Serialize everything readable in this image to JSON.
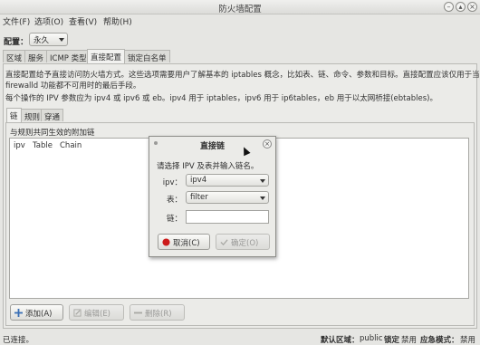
{
  "window": {
    "title": "防火墙配置"
  },
  "menu": [
    "文件(F)",
    "选项(O)",
    "查看(V)",
    "帮助(H)"
  ],
  "config": {
    "label": "配置：",
    "value": "永久"
  },
  "tabs": [
    "区域",
    "服务",
    "ICMP 类型",
    "直接配置",
    "锁定白名单"
  ],
  "description": {
    "line1": "直接配置给予直接访问防火墙方式。这些选项需要用户了解基本的 iptables 概念，比如表、链、命令、参数和目标。直接配置应该仅用于当其他",
    "line2": "firewalld 功能都不可用时的最后手段。",
    "line3": "每个操作的 IPV 参数应为 ipv4 或 ipv6 或 eb。ipv4 用于 iptables，ipv6 用于 ip6tables，eb 用于以太网桥接(ebtables)。"
  },
  "subtabs": [
    "链",
    "规则",
    "穿通"
  ],
  "chains": {
    "description": "与规则共同生效的附加链",
    "columns": [
      "ipv",
      "Table",
      "Chain"
    ]
  },
  "buttons": {
    "add": "添加(A)",
    "edit": "编辑(E)",
    "remove": "删除(R)"
  },
  "status": {
    "connection": "已连接。",
    "default_zone_label": "默认区域：",
    "default_zone_value": "public",
    "lockdown_label": "锁定",
    "lockdown_value": "禁用",
    "panic_label": "应急模式：",
    "panic_value": "禁用"
  },
  "dialog": {
    "title": "直接链",
    "prompt": "请选择 IPV 及表并输入链名。",
    "ipv_label": "ipv：",
    "ipv_value": "ipv4",
    "table_label": "表：",
    "table_value": "filter",
    "chain_label": "链：",
    "chain_value": "",
    "cancel": "取消(C)",
    "ok": "确定(O)"
  },
  "colors": {
    "cancel_icon": "#cc1a1a",
    "add_icon": "#3a6fb5"
  }
}
